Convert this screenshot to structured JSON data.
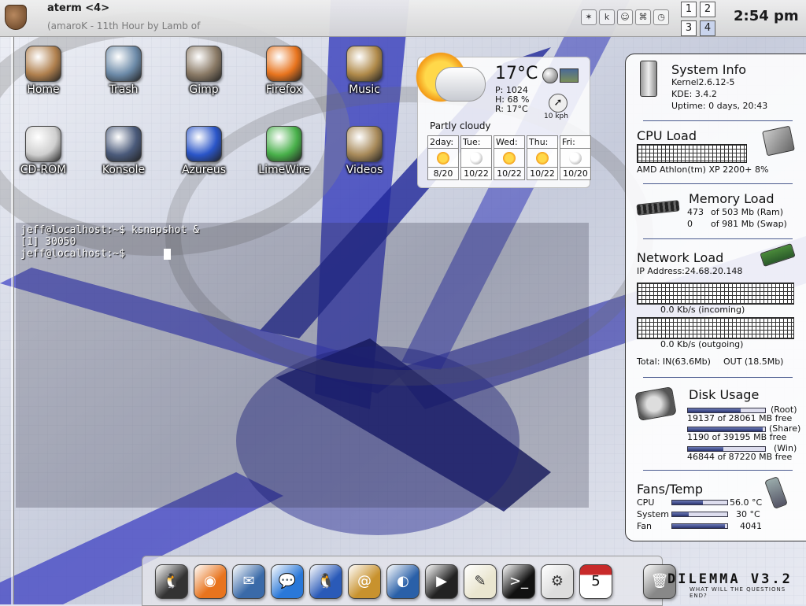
{
  "taskbar": {
    "title": "aterm <4>",
    "subtitle": "(amaroK - 11th Hour by Lamb of",
    "tray_icons": [
      "konqueror-icon",
      "kde-icon",
      "user-icon",
      "network-icon",
      "clock-icon"
    ],
    "tray_glyphs": [
      "✶",
      "k",
      "☺",
      "⌘",
      "◷"
    ],
    "pager": [
      "1",
      "2",
      "3",
      "4"
    ],
    "active_desktop": "4",
    "clock": "2:54 pm"
  },
  "desktop_icons": [
    {
      "label": "Home",
      "icon": "home-icon",
      "color": "#b0804e"
    },
    {
      "label": "Trash",
      "icon": "trash-icon",
      "color": "#6c8aa8"
    },
    {
      "label": "Gimp",
      "icon": "gimp-icon",
      "color": "#8a7a66"
    },
    {
      "label": "Firefox",
      "icon": "firefox-icon",
      "color": "#e8741e"
    },
    {
      "label": "Music",
      "icon": "music-folder-icon",
      "color": "#b08a4a"
    },
    {
      "label": "CD-ROM",
      "icon": "cdrom-icon",
      "color": "#cfcfcf"
    },
    {
      "label": "Konsole",
      "icon": "konsole-icon",
      "color": "#4a5a7a"
    },
    {
      "label": "Azureus",
      "icon": "azureus-frog-icon",
      "color": "#2a55c8"
    },
    {
      "label": "LimeWire",
      "icon": "limewire-icon",
      "color": "#48b04a"
    },
    {
      "label": "Videos",
      "icon": "videos-folder-icon",
      "color": "#a88a5a"
    }
  ],
  "weather": {
    "temperature": "17°C",
    "pressure": "P:  1024",
    "humidity": "H:  68 %",
    "realfeel": "R:  17°C",
    "wind": "10 kph",
    "condition": "Partly cloudy",
    "forecast": [
      {
        "day": "2day:",
        "date": "8/20",
        "icon": "sunny"
      },
      {
        "day": "Tue:",
        "date": "10/22",
        "icon": "cloudy"
      },
      {
        "day": "Wed:",
        "date": "10/22",
        "icon": "sunny"
      },
      {
        "day": "Thu:",
        "date": "10/22",
        "icon": "sunny"
      },
      {
        "day": "Fri:",
        "date": "10/20",
        "icon": "cloudy"
      }
    ]
  },
  "terminal": {
    "lines": [
      "jeff@localhost:~$ ksnapshot &",
      "[1] 30050",
      "jeff@localhost:~$ "
    ]
  },
  "system_info": {
    "title": "System Info",
    "kernel": "Kernel2.6.12-5",
    "kde": "KDE: 3.4.2",
    "uptime": "Uptime: 0 days, 20:43"
  },
  "cpu": {
    "title": "CPU Load",
    "model": "AMD Athlon(tm) XP 2200+",
    "usage": "8%",
    "usage_fraction": 0.08
  },
  "memory": {
    "title": "Memory Load",
    "ram_used": "473",
    "ram_text": "of 503 Mb (Ram)",
    "swap_used": "0",
    "swap_text": "of 981 Mb (Swap)"
  },
  "network": {
    "title": "Network Load",
    "ip": "IP Address:24.68.20.148",
    "incoming": "0.0 Kb/s      (incoming)",
    "outgoing": "0.0 Kb/s      (outgoing)",
    "total_in": "Total: IN(63.6Mb)",
    "total_out": "OUT (18.5Mb)"
  },
  "disk": {
    "title": "Disk Usage",
    "entries": [
      {
        "name": "(Root)",
        "text": "19137 of 28061 MB free",
        "fraction": 0.68
      },
      {
        "name": "(Share)",
        "text": "1190 of 39195 MB free",
        "fraction": 0.97
      },
      {
        "name": "(Win)",
        "text": "46844 of 87220 MB free",
        "fraction": 0.46
      }
    ]
  },
  "fans": {
    "title": "Fans/Temp",
    "rows": [
      {
        "label": "CPU",
        "value": "56.0 °C",
        "fraction": 0.56
      },
      {
        "label": "System",
        "value": "30 °C",
        "fraction": 0.3
      },
      {
        "label": "Fan",
        "value": "4041",
        "fraction": 0.95
      }
    ]
  },
  "dock": [
    {
      "app": "tux-icon",
      "glyph": "🐧",
      "color": "#333"
    },
    {
      "app": "firefox-icon",
      "glyph": "◉",
      "color": "#e8741e"
    },
    {
      "app": "mail-stamp-icon",
      "glyph": "✉",
      "color": "#3a6aa8"
    },
    {
      "app": "chat-bubble-icon",
      "glyph": "💬",
      "color": "#2a78d8"
    },
    {
      "app": "gaim-penguin-icon",
      "glyph": "🐧",
      "color": "#2a5ab8"
    },
    {
      "app": "address-book-icon",
      "glyph": "@",
      "color": "#c8922e"
    },
    {
      "app": "browser-globe-icon",
      "glyph": "◐",
      "color": "#2a60a8"
    },
    {
      "app": "video-clapper-icon",
      "glyph": "▶",
      "color": "#222"
    },
    {
      "app": "text-editor-icon",
      "glyph": "✎",
      "color": "#eae6d0"
    },
    {
      "app": "terminal-icon",
      "glyph": ">_",
      "color": "#111"
    },
    {
      "app": "system-settings-icon",
      "glyph": "⚙",
      "color": "#ddd"
    },
    {
      "app": "calendar-icon",
      "glyph": "5",
      "color": "#c82a2a"
    },
    {
      "app": "trash-bin-icon",
      "glyph": "🗑",
      "color": "#888"
    }
  ],
  "calendar_day": "5",
  "logo": {
    "text": "DILEMMA V3.2",
    "tagline": "WHAT WILL THE QUESTIONS END?"
  }
}
